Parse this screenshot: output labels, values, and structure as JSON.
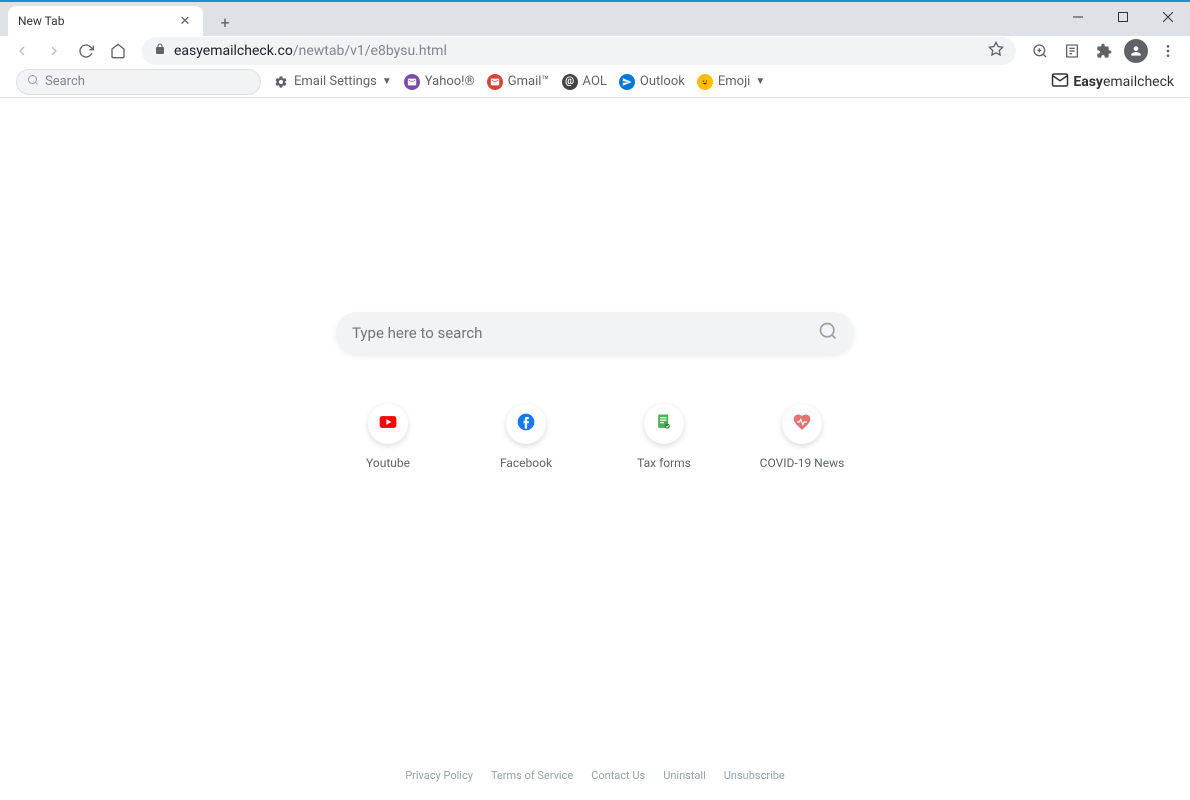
{
  "tab": {
    "title": "New Tab"
  },
  "url": {
    "domain": "easyemailcheck.co",
    "path": "/newtab/v1/e8bysu.html"
  },
  "page_toolbar": {
    "search_placeholder": "Search",
    "items": [
      {
        "label": "Email Settings",
        "has_chevron": true,
        "icon": "gear"
      },
      {
        "label": "Yahoo!®",
        "has_chevron": false,
        "icon": "mail-purple"
      },
      {
        "label": "Gmail™",
        "has_chevron": false,
        "icon": "mail-red"
      },
      {
        "label": "AOL",
        "has_chevron": false,
        "icon": "at"
      },
      {
        "label": "Outlook",
        "has_chevron": false,
        "icon": "send"
      },
      {
        "label": "Emoji",
        "has_chevron": true,
        "icon": "smile"
      }
    ],
    "brand": {
      "bold": "Easy",
      "rest": "emailcheck"
    }
  },
  "main_search": {
    "placeholder": "Type here to search"
  },
  "shortcuts": [
    {
      "label": "Youtube",
      "icon": "youtube"
    },
    {
      "label": "Facebook",
      "icon": "facebook"
    },
    {
      "label": "Tax forms",
      "icon": "taxforms"
    },
    {
      "label": "COVID-19 News",
      "icon": "covid"
    }
  ],
  "footer": [
    "Privacy Policy",
    "Terms of Service",
    "Contact Us",
    "Uninstall",
    "Unsubscribe"
  ]
}
